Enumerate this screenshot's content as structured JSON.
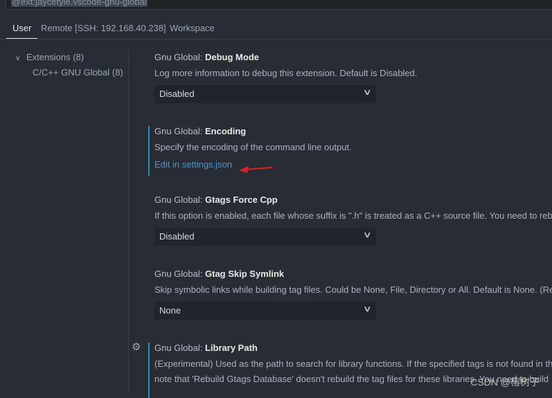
{
  "search": {
    "value": "@ext:jaycetyle.vscode-gnu-global"
  },
  "tabs": [
    {
      "label": "User",
      "active": true
    },
    {
      "label": "Remote [SSH: 192.168.40.238]"
    },
    {
      "label": "Workspace"
    }
  ],
  "tree": {
    "group": "Extensions (8)",
    "item": "C/C++ GNU Global (8)"
  },
  "settings": [
    {
      "prefix": "Gnu Global: ",
      "name": "Debug Mode",
      "desc": "Log more information to debug this extension. Default is Disabled.",
      "value": "Disabled"
    },
    {
      "prefix": "Gnu Global: ",
      "name": "Encoding",
      "desc": "Specify the encoding of the command line output.",
      "link": "Edit in settings.json"
    },
    {
      "prefix": "Gnu Global: ",
      "name": "Gtags Force Cpp",
      "desc": "If this option is enabled, each file whose suffix is \".h\" is treated as a C++ source file. You need to rebu",
      "value": "Disabled"
    },
    {
      "prefix": "Gnu Global: ",
      "name": "Gtag Skip Symlink",
      "desc": "Skip symbolic links while building tag files. Could be None, File, Directory or All. Default is None. (Re",
      "value": "None"
    },
    {
      "prefix": "Gnu Global: ",
      "name": "Library Path",
      "desc": "(Experimental) Used as the path to search for library functions. If the specified tags is not found in th",
      "desc2": "note that 'Rebuild Gtags Database' doesn't rebuild the tag files for these libraries. You need to build"
    }
  ],
  "watermark": "CSDN @榕树子",
  "colors": {
    "accent": "#2d8fb5",
    "link": "#3e9bd6",
    "arrow": "#e02020"
  }
}
